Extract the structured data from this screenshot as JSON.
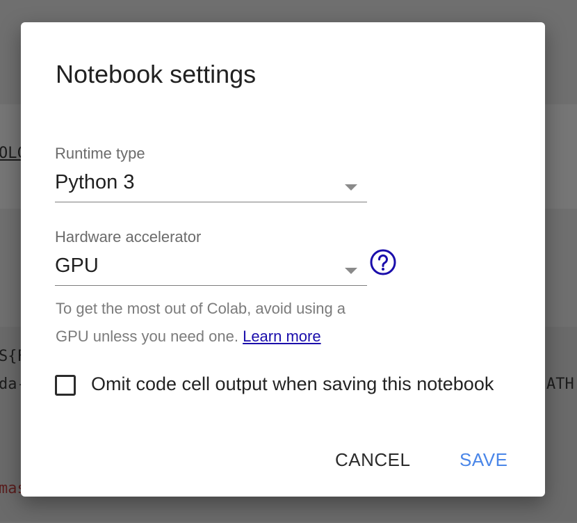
{
  "dialog": {
    "title": "Notebook settings",
    "runtime": {
      "label": "Runtime type",
      "value": "Python 3"
    },
    "hardware": {
      "label": "Hardware accelerator",
      "value": "GPU"
    },
    "hint": {
      "text": "To get the most out of Colab, avoid using a GPU unless you need one.",
      "link": "Learn more"
    },
    "omit_output": {
      "label": "Omit code cell output when saving this notebook",
      "checked": false
    },
    "buttons": {
      "cancel": "CANCEL",
      "save": "SAVE"
    }
  },
  "background": {
    "snippets": [
      "OLC",
      "S{F",
      "da-",
      "ATH",
      "mas"
    ]
  },
  "colors": {
    "accent": "#4a86e8",
    "link": "#1a0dab",
    "help_icon": "#1a0dab"
  }
}
